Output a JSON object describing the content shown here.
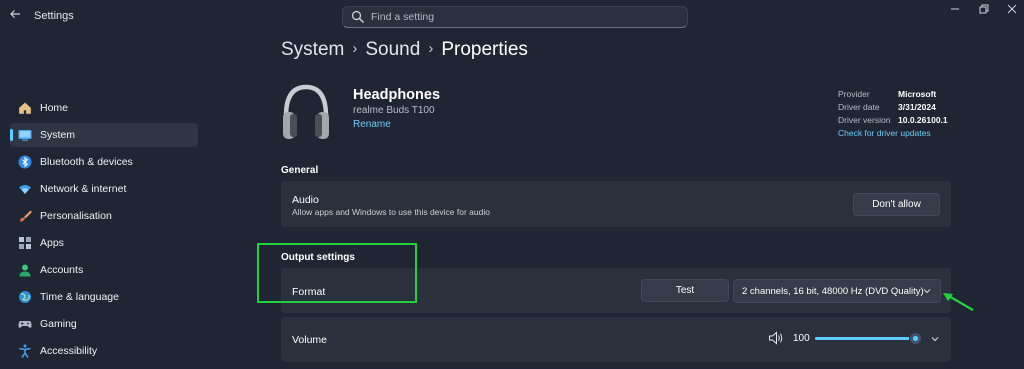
{
  "app": {
    "title": "Settings"
  },
  "search": {
    "placeholder": "Find a setting"
  },
  "sidebar": {
    "items": [
      {
        "label": "Home",
        "icon": "home-icon",
        "active": false
      },
      {
        "label": "System",
        "icon": "system-icon",
        "active": true
      },
      {
        "label": "Bluetooth & devices",
        "icon": "bluetooth-icon",
        "active": false
      },
      {
        "label": "Network & internet",
        "icon": "wifi-icon",
        "active": false
      },
      {
        "label": "Personalisation",
        "icon": "brush-icon",
        "active": false
      },
      {
        "label": "Apps",
        "icon": "apps-icon",
        "active": false
      },
      {
        "label": "Accounts",
        "icon": "person-icon",
        "active": false
      },
      {
        "label": "Time & language",
        "icon": "globe-icon",
        "active": false
      },
      {
        "label": "Gaming",
        "icon": "gamepad-icon",
        "active": false
      },
      {
        "label": "Accessibility",
        "icon": "accessibility-icon",
        "active": false
      }
    ]
  },
  "breadcrumb": {
    "items": [
      "System",
      "Sound"
    ],
    "current": "Properties"
  },
  "device": {
    "name": "Headphones",
    "model": "realme Buds T100",
    "rename_label": "Rename"
  },
  "driver_info": {
    "provider_label": "Provider",
    "provider_value": "Microsoft",
    "date_label": "Driver date",
    "date_value": "3/31/2024",
    "version_label": "Driver version",
    "version_value": "10.0.26100.1",
    "update_link": "Check for driver updates"
  },
  "general": {
    "title": "General",
    "audio_title": "Audio",
    "audio_desc": "Allow apps and Windows to use this device for audio",
    "dont_allow_label": "Don't allow"
  },
  "output": {
    "title": "Output settings",
    "format_label": "Format",
    "test_label": "Test",
    "format_value": "2 channels, 16 bit, 48000 Hz (DVD Quality)",
    "volume_label": "Volume",
    "volume_value": "100"
  },
  "colors": {
    "accent": "#60cdff",
    "highlight": "#22d23a",
    "background": "#1f2533",
    "card": "#2a303c"
  }
}
